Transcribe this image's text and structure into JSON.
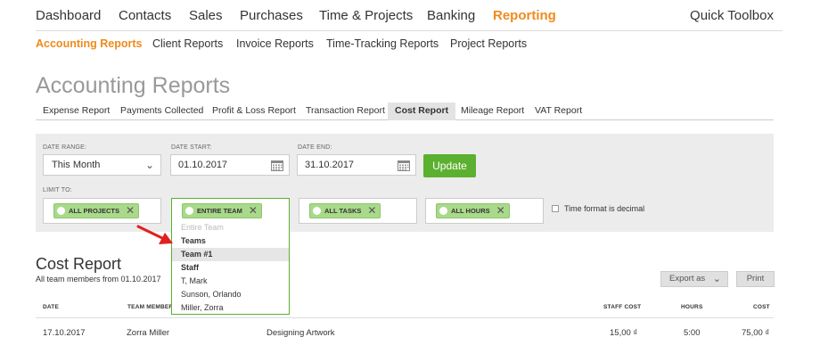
{
  "topnav": {
    "items": [
      "Dashboard",
      "Contacts",
      "Sales",
      "Purchases",
      "Time & Projects",
      "Banking",
      "Reporting"
    ],
    "active": "Reporting",
    "toolbox": "Quick Toolbox"
  },
  "subnav": {
    "items": [
      "Accounting Reports",
      "Client Reports",
      "Invoice Reports",
      "Time-Tracking Reports",
      "Project Reports"
    ],
    "active": "Accounting Reports"
  },
  "page_title": "Accounting Reports",
  "tabs": {
    "items": [
      "Expense Report",
      "Payments Collected",
      "Profit & Loss Report",
      "Transaction Report",
      "Cost Report",
      "Mileage Report",
      "VAT Report"
    ],
    "active": "Cost Report"
  },
  "filters": {
    "date_range_label": "DATE RANGE:",
    "date_range_value": "This Month",
    "date_start_label": "DATE START:",
    "date_start_value": "01.10.2017",
    "date_end_label": "DATE END:",
    "date_end_value": "31.10.2017",
    "update_label": "Update",
    "limit_label": "LIMIT TO:",
    "tags": [
      "ALL PROJECTS",
      "ENTIRE TEAM",
      "ALL TASKS",
      "ALL HOURS"
    ],
    "decimal_label": "Time format is decimal",
    "decimal_checked": false
  },
  "team_dropdown": {
    "placeholder": "Entire Team",
    "teams_header": "Teams",
    "selected": "Team #1",
    "staff_header": "Staff",
    "staff": [
      "T, Mark",
      "Sunson, Orlando",
      "Miller, Zorra"
    ]
  },
  "report": {
    "title": "Cost Report",
    "subtitle": "All team members from 01.10.2017",
    "export_label": "Export as",
    "print_label": "Print",
    "columns": [
      "DATE",
      "TEAM MEMBER",
      "STAFF COST",
      "HOURS",
      "COST"
    ],
    "rows": [
      {
        "date": "17.10.2017",
        "member": "Zorra Miller",
        "task": "Designing Artwork",
        "staff_cost": "15,00 ₫",
        "hours": "5:00",
        "cost": "75,00 ₫"
      }
    ]
  },
  "colors": {
    "accent": "#f08a1c",
    "green": "#5cb030",
    "tag_green": "#a9d98a",
    "arrow": "#e02020"
  }
}
